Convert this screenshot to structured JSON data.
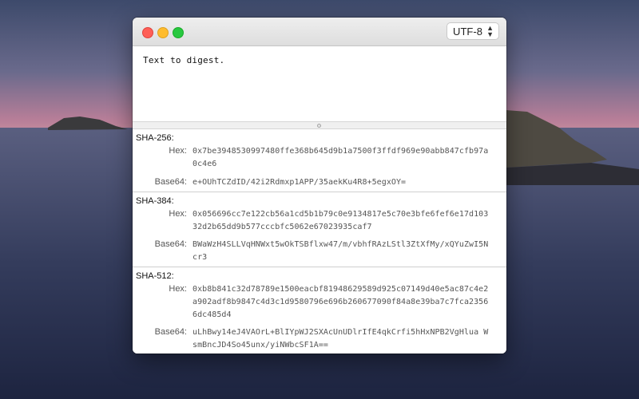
{
  "window": {
    "encoding": "UTF-8",
    "input_text": "Text to digest."
  },
  "digests": [
    {
      "algorithm": "SHA-256:",
      "hex_label": "Hex:",
      "hex": "0x7be3948530997480ffe368b645d9b1a7500f3ffdf969e90abb847cfb97a0c4e6",
      "b64_label": "Base64:",
      "base64": "e+OUhTCZdID/42i2Rdmxp1APP/35aekKu4R8+5egxOY="
    },
    {
      "algorithm": "SHA-384:",
      "hex_label": "Hex:",
      "hex": "0x056696cc7e122cb56a1cd5b1b79c0e9134817e5c70e3bfe6fef6e17d10332d2b65dd9b577cccbfc5062e67023935caf7",
      "b64_label": "Base64:",
      "base64": "BWaWzH4SLLVqHNWxt5wOkTSBflxw47/m/vbhfRAzLStl3ZtXfMy/xQYuZwI5Ncr3"
    },
    {
      "algorithm": "SHA-512:",
      "hex_label": "Hex:",
      "hex": "0xb8b841c32d78789e1500eacbf81948629589d925c07149d40e5ac87c4e2a902adf8b9847c4d3c1d9580796e696b260677090f84a8e39ba7c7fca23566dc485d4",
      "b64_label": "Base64:",
      "base64": "uLhBwy14eJ4VAOrL+BlIYpWJ2SXAcUnUDlrIfE4qkCrfi5hHxNPB2VgHlua WsmBncJD4So45unx/yiNWbcSF1A=="
    }
  ]
}
